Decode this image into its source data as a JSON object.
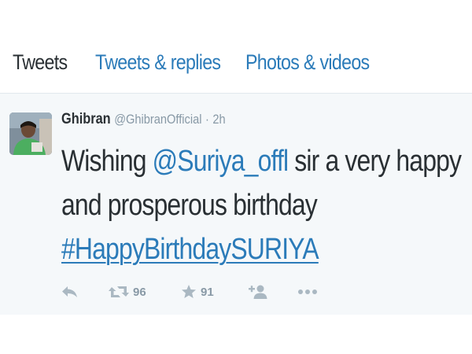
{
  "tabs": [
    {
      "label": "Tweets",
      "active": true
    },
    {
      "label": "Tweets & replies",
      "active": false
    },
    {
      "label": "Photos & videos",
      "active": false
    }
  ],
  "tweet": {
    "fullname": "Ghibran",
    "username": "@GhibranOfficial",
    "separator": "·",
    "time": "2h",
    "text_parts": {
      "prefix": "Wishing ",
      "mention": "@Suriya_offl",
      "after_mention": " sir a very happy and prosperous birthday",
      "hashtag": "#HappyBirthdaySURIYA"
    },
    "actions": {
      "reply_icon": "reply-icon",
      "retweet_icon": "retweet-icon",
      "retweet_count": "96",
      "favorite_icon": "star-icon",
      "favorite_count": "91",
      "follow_icon": "add-user-icon",
      "more_icon": "more-icon"
    }
  },
  "colors": {
    "link": "#2b7bb9",
    "text": "#292f33",
    "muted": "#8899a6",
    "icon": "#aab8c2",
    "tweet_bg": "#f5f8fa"
  }
}
